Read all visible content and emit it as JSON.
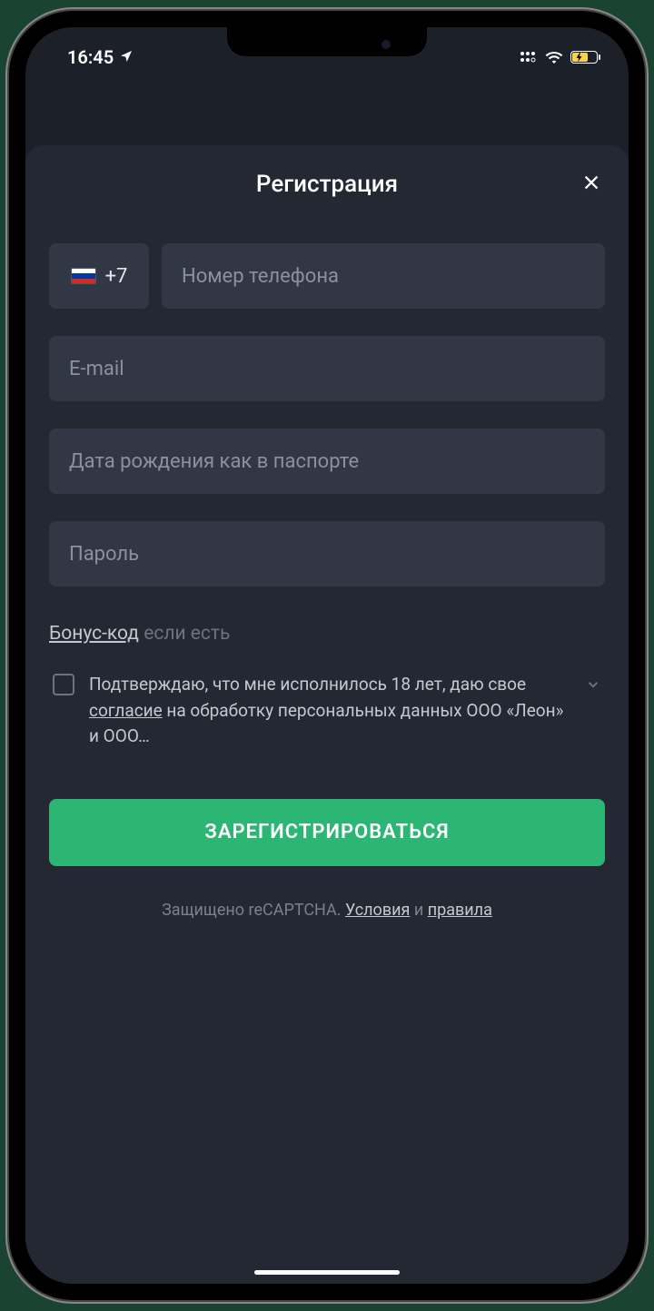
{
  "status": {
    "time": "16:45",
    "location_icon": "location-arrow",
    "signal_icon": "signal-dots",
    "wifi_icon": "wifi",
    "battery_charging": true
  },
  "sheet": {
    "title": "Регистрация",
    "close_icon": "close"
  },
  "form": {
    "country_code": "+7",
    "country_flag": "russia",
    "phone_placeholder": "Номер телефона",
    "email_placeholder": "E-mail",
    "dob_placeholder": "Дата рождения как в паспорте",
    "password_placeholder": "Пароль"
  },
  "bonus": {
    "link": "Бонус-код",
    "hint": " если есть"
  },
  "consent": {
    "checked": false,
    "text_before": "Подтверждаю, что мне исполнилось 18 лет, даю свое ",
    "agreement_word": "согласие",
    "text_after": " на обработку персональных данных ООО «Леон» и ООО…"
  },
  "submit": {
    "label": "ЗАРЕГИСТРИРОВАТЬСЯ"
  },
  "recaptcha": {
    "prefix": "Защищено reCAPTCHA. ",
    "terms": "Условия",
    "and": " и ",
    "rules": "правила"
  }
}
